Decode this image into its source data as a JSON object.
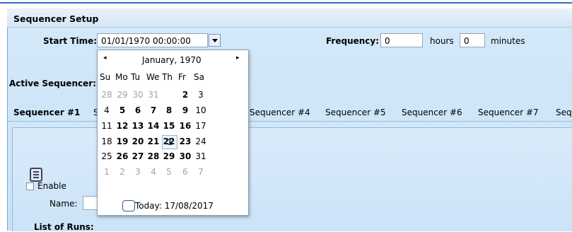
{
  "header": {
    "title": "Sequencer Setup"
  },
  "start_time": {
    "label": "Start Time:",
    "value": "01/01/1970 00:00:00"
  },
  "frequency": {
    "label": "Frequency:",
    "hours_value": "0",
    "hours_label": "hours",
    "minutes_value": "0",
    "minutes_label": "minutes"
  },
  "active_sequencer": {
    "label": "Active Sequencer:"
  },
  "tabs": [
    "Sequencer #1",
    "S",
    "Sequencer #4",
    "Sequencer #5",
    "Sequencer #6",
    "Sequencer #7",
    "Seq"
  ],
  "panel": {
    "enable_label": "Enable",
    "name_label": "Name:",
    "runs_label": "List of Runs:"
  },
  "calendar": {
    "month": "January, 1970",
    "prev": "◂",
    "next": "▸",
    "dow": [
      "Su",
      "Mo",
      "Tu",
      "We",
      "Th",
      "Fr",
      "Sa"
    ],
    "weeks": [
      [
        "28",
        "29",
        "30",
        "31",
        "1",
        "2",
        "3"
      ],
      [
        "4",
        "5",
        "6",
        "7",
        "8",
        "9",
        "10"
      ],
      [
        "11",
        "12",
        "13",
        "14",
        "15",
        "16",
        "17"
      ],
      [
        "18",
        "19",
        "20",
        "21",
        "22",
        "23",
        "24"
      ],
      [
        "25",
        "26",
        "27",
        "28",
        "29",
        "30",
        "31"
      ],
      [
        "1",
        "2",
        "3",
        "4",
        "5",
        "6",
        "7"
      ]
    ],
    "today": "Today: 17/08/2017"
  },
  "icons": {
    "dropdown": "chevron-down-icon",
    "runs": "list-icon"
  }
}
